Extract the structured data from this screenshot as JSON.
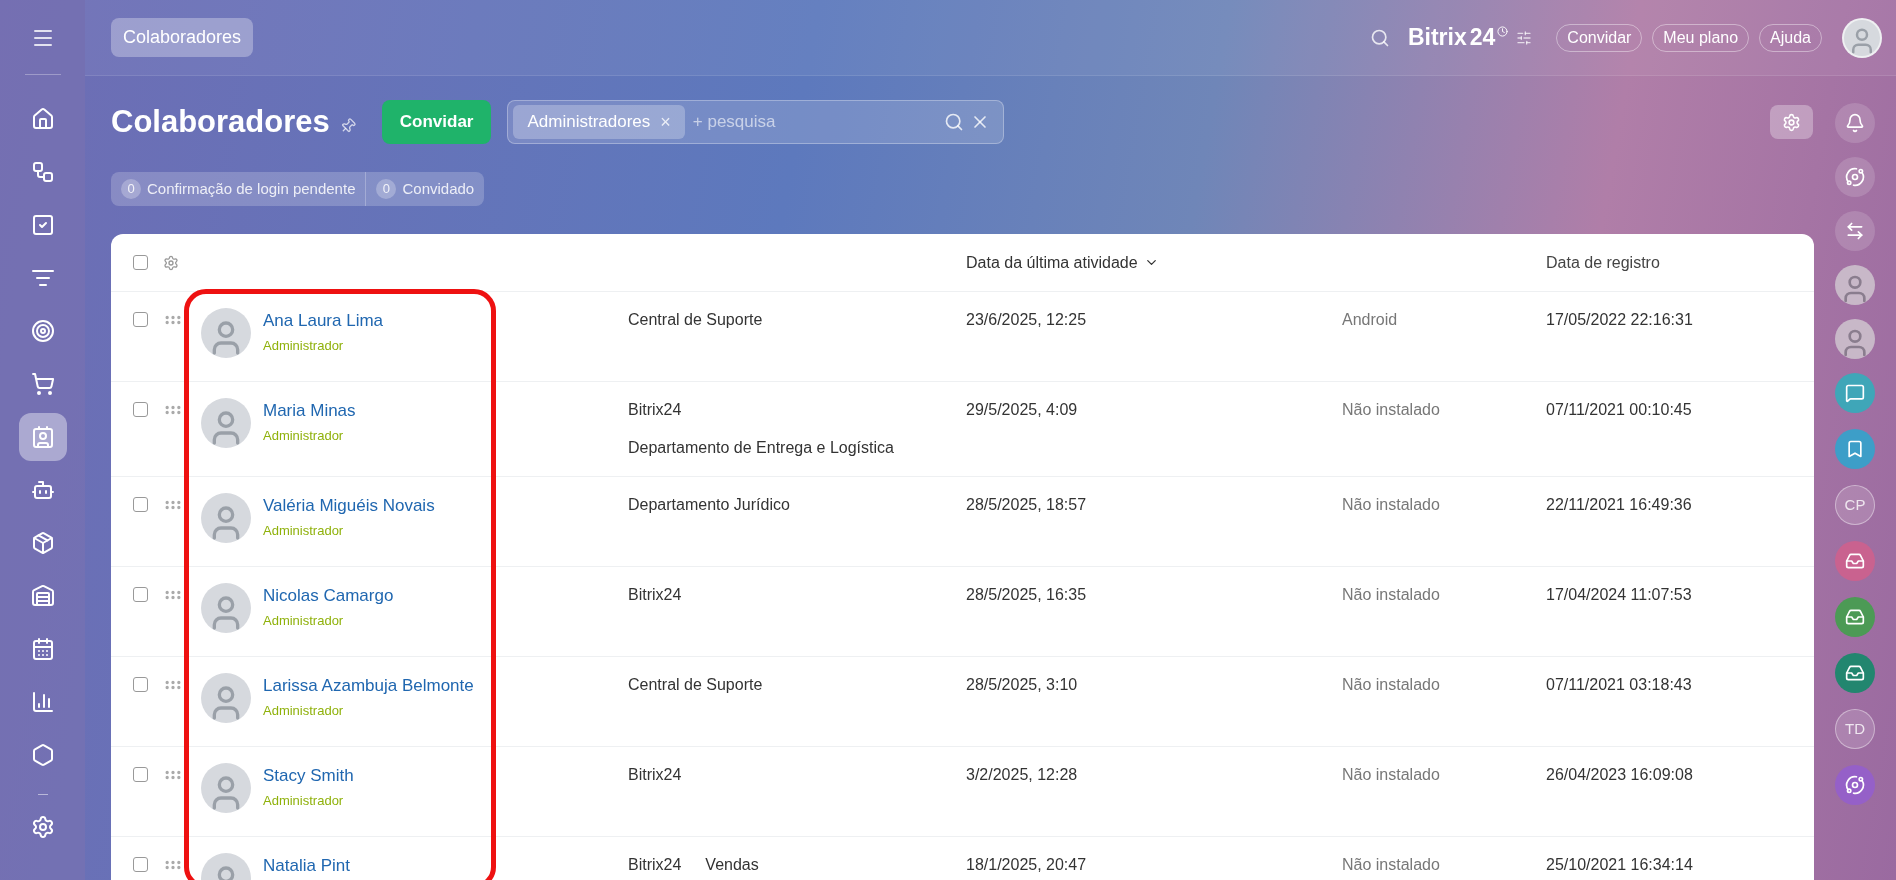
{
  "left_nav": [
    {
      "selected": false
    },
    {
      "selected": false
    },
    {
      "selected": false
    },
    {
      "selected": false
    },
    {
      "selected": false
    },
    {
      "selected": false
    },
    {
      "selected": true
    },
    {
      "selected": false
    },
    {
      "selected": false
    },
    {
      "selected": false
    },
    {
      "selected": false
    },
    {
      "selected": false
    },
    {
      "selected": false
    }
  ],
  "top_bar": {
    "breadcrumb": "Colaboradores",
    "logo": "Bitrix",
    "logo_number": "24",
    "buttons": [
      "Convidar",
      "Meu plano",
      "Ajuda"
    ]
  },
  "page": {
    "title": "Colaboradores",
    "invite_button": "Convidar",
    "filter": {
      "tag": "Administradores",
      "tag_remove": "×",
      "placeholder": "+ pesquisa"
    },
    "counters": [
      {
        "count": "0",
        "label": "Confirmação de login pendente"
      },
      {
        "count": "0",
        "label": "Convidado"
      }
    ]
  },
  "table": {
    "select_all_checked": false,
    "columns": [
      {
        "label": "Data da última atividade",
        "sorted": true
      },
      {
        "label": "Data de registro",
        "sorted": false
      }
    ],
    "rows": [
      {
        "checked": false,
        "name": "Ana Laura Lima",
        "role": "Administrador",
        "departments": [
          "Central de Suporte"
        ],
        "last_activity": "23/6/2025, 12:25",
        "app": "Android",
        "registered": "17/05/2022 22:16:31"
      },
      {
        "checked": false,
        "name": "Maria Minas",
        "role": "Administrador",
        "departments": [
          "Bitrix24",
          "Departamento de Entrega e Logística"
        ],
        "last_activity": "29/5/2025, 4:09",
        "app": "Não instalado",
        "registered": "07/11/2021 00:10:45"
      },
      {
        "checked": false,
        "name": "Valéria Miguéis Novais",
        "role": "Administrador",
        "departments": [
          "Departamento Jurídico"
        ],
        "last_activity": "28/5/2025, 18:57",
        "app": "Não instalado",
        "registered": "22/11/2021 16:49:36"
      },
      {
        "checked": false,
        "name": "Nicolas Camargo",
        "role": "Administrador",
        "departments": [
          "Bitrix24"
        ],
        "last_activity": "28/5/2025, 16:35",
        "app": "Não instalado",
        "registered": "17/04/2024 11:07:53"
      },
      {
        "checked": false,
        "name": "Larissa Azambuja Belmonte",
        "role": "Administrador",
        "departments": [
          "Central de Suporte"
        ],
        "last_activity": "28/5/2025, 3:10",
        "app": "Não instalado",
        "registered": "07/11/2021 03:18:43"
      },
      {
        "checked": false,
        "name": "Stacy Smith",
        "role": "Administrador",
        "departments": [
          "Bitrix24"
        ],
        "last_activity": "3/2/2025, 12:28",
        "app": "Não instalado",
        "registered": "26/04/2023 16:09:08"
      },
      {
        "checked": false,
        "name": "Natalia Pint",
        "departments": [
          "Bitrix24",
          "Vendas"
        ],
        "last_activity": "18/1/2025, 20:47",
        "app": "Não instalado",
        "registered": "25/10/2021 16:34:14"
      }
    ]
  },
  "right_rail": [
    {
      "kind": "icon"
    },
    {
      "kind": "icon"
    },
    {
      "kind": "icon"
    },
    {
      "kind": "avatar"
    },
    {
      "kind": "avatar"
    },
    {
      "kind": "app",
      "color": "#3fa6b8"
    },
    {
      "kind": "app",
      "color": "#3d9ec8"
    },
    {
      "kind": "initials",
      "text": "CP"
    },
    {
      "kind": "app",
      "color": "#c9628f"
    },
    {
      "kind": "app",
      "color": "#4c9a55"
    },
    {
      "kind": "app",
      "color": "#22866f"
    },
    {
      "kind": "initials",
      "text": "TD"
    },
    {
      "kind": "app",
      "color": "#9560c8"
    }
  ]
}
